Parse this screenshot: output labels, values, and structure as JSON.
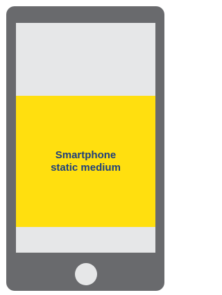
{
  "device": {
    "type": "smartphone",
    "body_color": "#696a6d",
    "screen_color": "#e6e7e8",
    "home_button_color": "#e6e7e8"
  },
  "ad_slot": {
    "label_line1": "Smartphone",
    "label_line2": "static medium",
    "background_color": "#ffdf0f",
    "text_color": "#1d3f7e"
  }
}
